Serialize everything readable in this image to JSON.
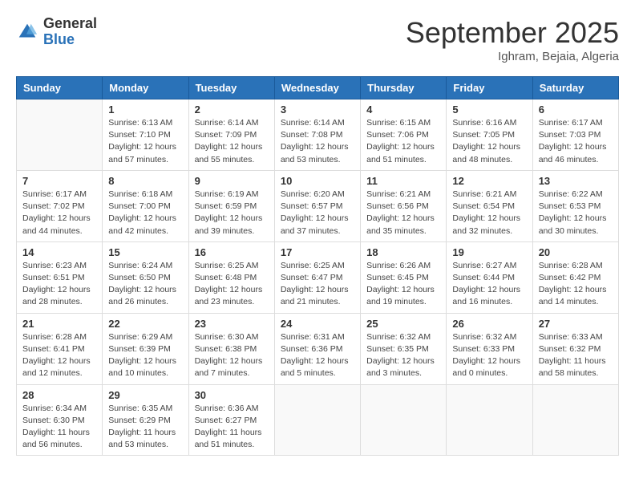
{
  "logo": {
    "general": "General",
    "blue": "Blue"
  },
  "title": "September 2025",
  "location": "Ighram, Bejaia, Algeria",
  "weekdays": [
    "Sunday",
    "Monday",
    "Tuesday",
    "Wednesday",
    "Thursday",
    "Friday",
    "Saturday"
  ],
  "weeks": [
    [
      {
        "day": "",
        "info": ""
      },
      {
        "day": "1",
        "info": "Sunrise: 6:13 AM\nSunset: 7:10 PM\nDaylight: 12 hours\nand 57 minutes."
      },
      {
        "day": "2",
        "info": "Sunrise: 6:14 AM\nSunset: 7:09 PM\nDaylight: 12 hours\nand 55 minutes."
      },
      {
        "day": "3",
        "info": "Sunrise: 6:14 AM\nSunset: 7:08 PM\nDaylight: 12 hours\nand 53 minutes."
      },
      {
        "day": "4",
        "info": "Sunrise: 6:15 AM\nSunset: 7:06 PM\nDaylight: 12 hours\nand 51 minutes."
      },
      {
        "day": "5",
        "info": "Sunrise: 6:16 AM\nSunset: 7:05 PM\nDaylight: 12 hours\nand 48 minutes."
      },
      {
        "day": "6",
        "info": "Sunrise: 6:17 AM\nSunset: 7:03 PM\nDaylight: 12 hours\nand 46 minutes."
      }
    ],
    [
      {
        "day": "7",
        "info": "Sunrise: 6:17 AM\nSunset: 7:02 PM\nDaylight: 12 hours\nand 44 minutes."
      },
      {
        "day": "8",
        "info": "Sunrise: 6:18 AM\nSunset: 7:00 PM\nDaylight: 12 hours\nand 42 minutes."
      },
      {
        "day": "9",
        "info": "Sunrise: 6:19 AM\nSunset: 6:59 PM\nDaylight: 12 hours\nand 39 minutes."
      },
      {
        "day": "10",
        "info": "Sunrise: 6:20 AM\nSunset: 6:57 PM\nDaylight: 12 hours\nand 37 minutes."
      },
      {
        "day": "11",
        "info": "Sunrise: 6:21 AM\nSunset: 6:56 PM\nDaylight: 12 hours\nand 35 minutes."
      },
      {
        "day": "12",
        "info": "Sunrise: 6:21 AM\nSunset: 6:54 PM\nDaylight: 12 hours\nand 32 minutes."
      },
      {
        "day": "13",
        "info": "Sunrise: 6:22 AM\nSunset: 6:53 PM\nDaylight: 12 hours\nand 30 minutes."
      }
    ],
    [
      {
        "day": "14",
        "info": "Sunrise: 6:23 AM\nSunset: 6:51 PM\nDaylight: 12 hours\nand 28 minutes."
      },
      {
        "day": "15",
        "info": "Sunrise: 6:24 AM\nSunset: 6:50 PM\nDaylight: 12 hours\nand 26 minutes."
      },
      {
        "day": "16",
        "info": "Sunrise: 6:25 AM\nSunset: 6:48 PM\nDaylight: 12 hours\nand 23 minutes."
      },
      {
        "day": "17",
        "info": "Sunrise: 6:25 AM\nSunset: 6:47 PM\nDaylight: 12 hours\nand 21 minutes."
      },
      {
        "day": "18",
        "info": "Sunrise: 6:26 AM\nSunset: 6:45 PM\nDaylight: 12 hours\nand 19 minutes."
      },
      {
        "day": "19",
        "info": "Sunrise: 6:27 AM\nSunset: 6:44 PM\nDaylight: 12 hours\nand 16 minutes."
      },
      {
        "day": "20",
        "info": "Sunrise: 6:28 AM\nSunset: 6:42 PM\nDaylight: 12 hours\nand 14 minutes."
      }
    ],
    [
      {
        "day": "21",
        "info": "Sunrise: 6:28 AM\nSunset: 6:41 PM\nDaylight: 12 hours\nand 12 minutes."
      },
      {
        "day": "22",
        "info": "Sunrise: 6:29 AM\nSunset: 6:39 PM\nDaylight: 12 hours\nand 10 minutes."
      },
      {
        "day": "23",
        "info": "Sunrise: 6:30 AM\nSunset: 6:38 PM\nDaylight: 12 hours\nand 7 minutes."
      },
      {
        "day": "24",
        "info": "Sunrise: 6:31 AM\nSunset: 6:36 PM\nDaylight: 12 hours\nand 5 minutes."
      },
      {
        "day": "25",
        "info": "Sunrise: 6:32 AM\nSunset: 6:35 PM\nDaylight: 12 hours\nand 3 minutes."
      },
      {
        "day": "26",
        "info": "Sunrise: 6:32 AM\nSunset: 6:33 PM\nDaylight: 12 hours\nand 0 minutes."
      },
      {
        "day": "27",
        "info": "Sunrise: 6:33 AM\nSunset: 6:32 PM\nDaylight: 11 hours\nand 58 minutes."
      }
    ],
    [
      {
        "day": "28",
        "info": "Sunrise: 6:34 AM\nSunset: 6:30 PM\nDaylight: 11 hours\nand 56 minutes."
      },
      {
        "day": "29",
        "info": "Sunrise: 6:35 AM\nSunset: 6:29 PM\nDaylight: 11 hours\nand 53 minutes."
      },
      {
        "day": "30",
        "info": "Sunrise: 6:36 AM\nSunset: 6:27 PM\nDaylight: 11 hours\nand 51 minutes."
      },
      {
        "day": "",
        "info": ""
      },
      {
        "day": "",
        "info": ""
      },
      {
        "day": "",
        "info": ""
      },
      {
        "day": "",
        "info": ""
      }
    ]
  ]
}
